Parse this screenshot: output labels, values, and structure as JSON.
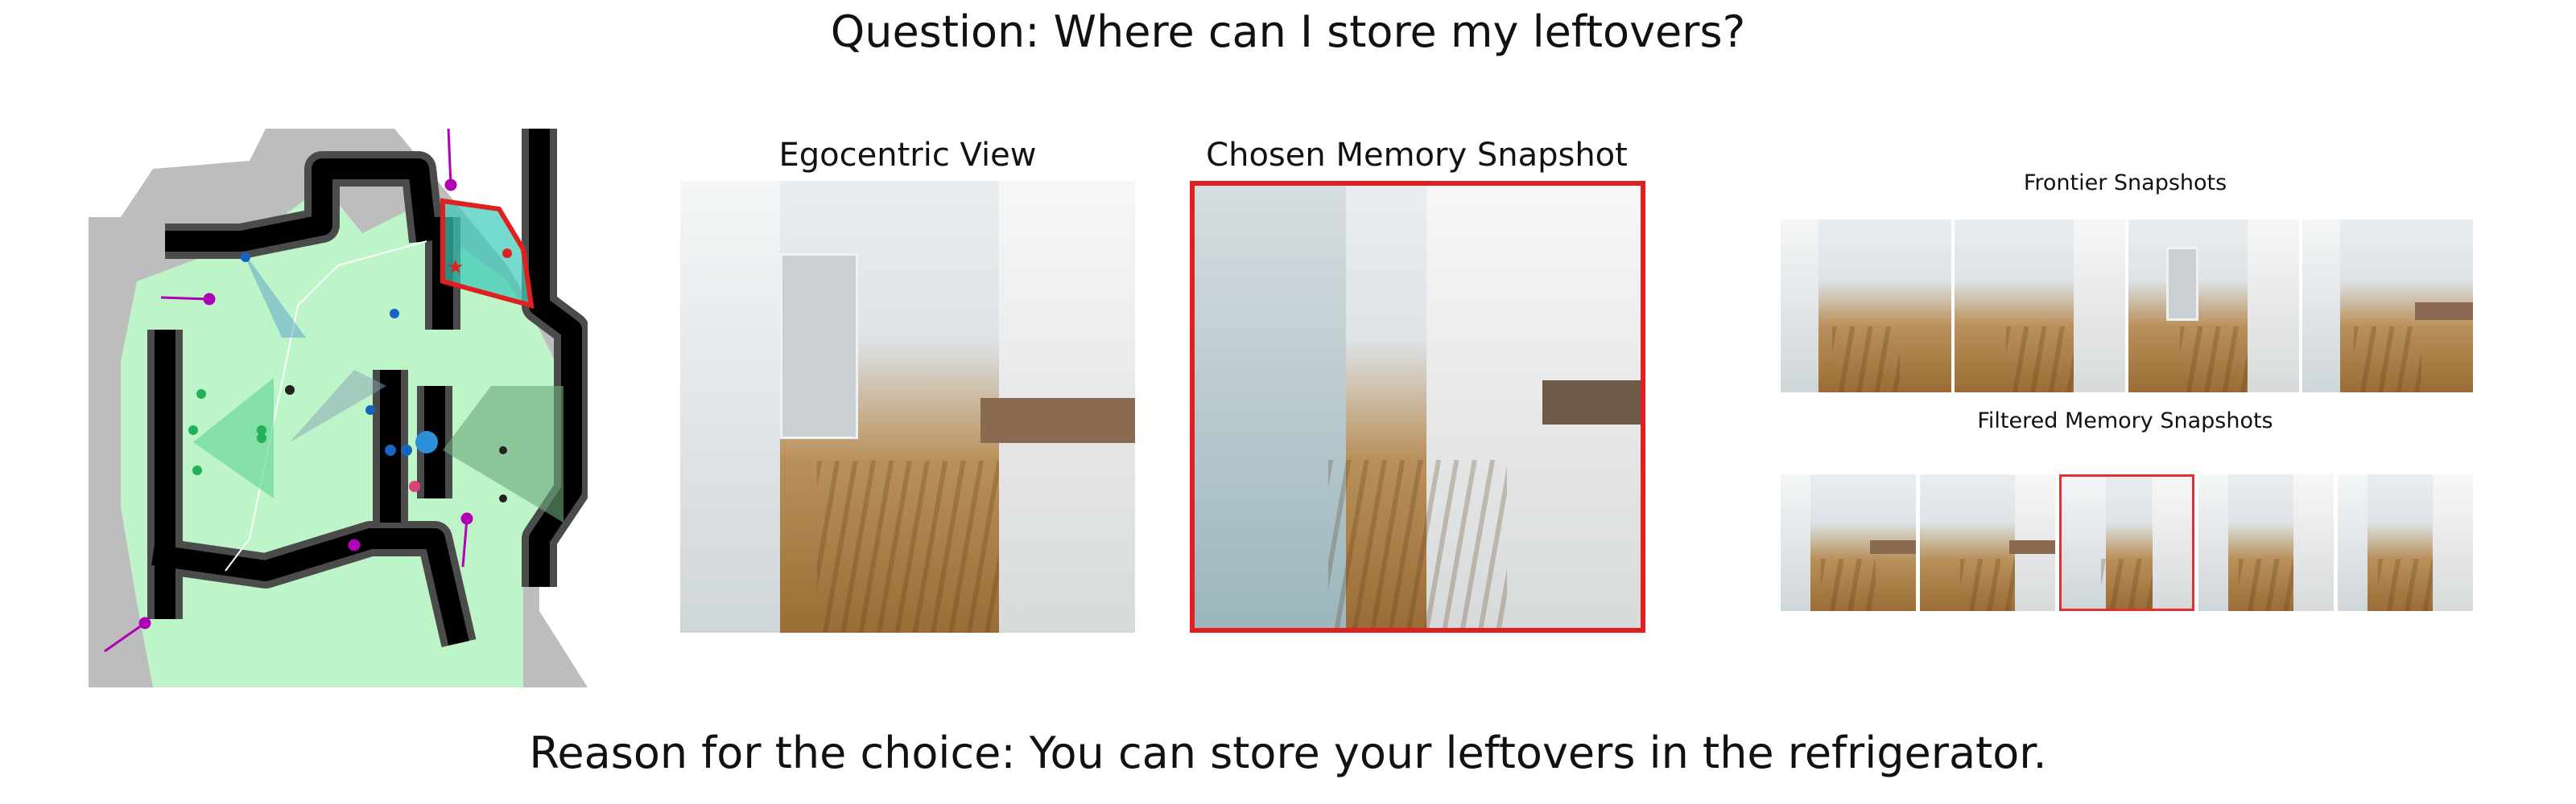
{
  "header": {
    "question": "Question: Where can I store my leftovers?"
  },
  "panels": {
    "egocentric_title": "Egocentric View",
    "chosen_title": "Chosen Memory Snapshot",
    "frontier_title": "Frontier Snapshots",
    "filtered_title": "Filtered Memory Snapshots"
  },
  "footer": {
    "reason": "Reason for the choice: You can store your leftovers in the refrigerator."
  },
  "colors": {
    "highlight_red": "#e02020",
    "explored_green": "#bdf5c8",
    "obstacle_black": "#000000",
    "frontier_purple": "#b000b8",
    "agent_blue": "#1565c0"
  },
  "frontier_snapshots": [
    {
      "icon": "frontier-snapshot-image"
    },
    {
      "icon": "frontier-snapshot-image"
    },
    {
      "icon": "frontier-snapshot-image"
    },
    {
      "icon": "frontier-snapshot-image"
    }
  ],
  "filtered_snapshots": [
    {
      "icon": "memory-snapshot-image",
      "selected": false
    },
    {
      "icon": "memory-snapshot-image",
      "selected": false
    },
    {
      "icon": "memory-snapshot-image",
      "selected": true
    },
    {
      "icon": "memory-snapshot-image",
      "selected": false
    },
    {
      "icon": "memory-snapshot-image",
      "selected": false
    }
  ]
}
